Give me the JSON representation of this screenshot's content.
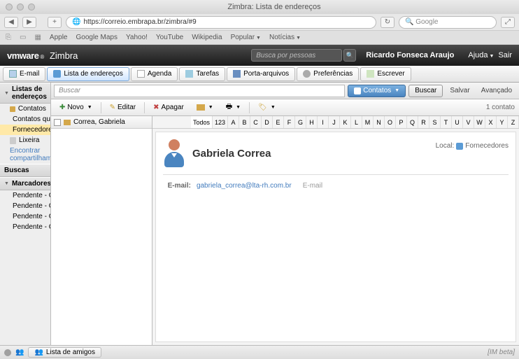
{
  "window": {
    "title": "Zimbra: Lista de endereços"
  },
  "browser": {
    "url": "https://correio.embrapa.br/zimbra/#9",
    "search_placeholder": "Google",
    "bookmarks": [
      "Apple",
      "Google Maps",
      "Yahoo!",
      "YouTube",
      "Wikipedia",
      "Popular",
      "Notícias"
    ]
  },
  "header": {
    "logo_a": "vmware",
    "logo_b": "Zimbra",
    "search_placeholder": "Busca por pessoas",
    "user": "Ricardo Fonseca Araujo",
    "help": "Ajuda",
    "exit": "Sair"
  },
  "tabs": {
    "email": "E-mail",
    "addressbook": "Lista de endereços",
    "calendar": "Agenda",
    "tasks": "Tarefas",
    "briefcase": "Porta-arquivos",
    "preferences": "Preferências",
    "compose": "Escrever"
  },
  "sidebar": {
    "addressbooks": {
      "title": "Listas de endereços",
      "items": [
        {
          "label": "Contatos"
        },
        {
          "label": "Contatos que receberam e"
        },
        {
          "label": "Fornecedores",
          "selected": true
        },
        {
          "label": "Lixeira",
          "trash": true
        }
      ],
      "share_link": "Encontrar compartilhament"
    },
    "searches": {
      "title": "Buscas"
    },
    "tags": {
      "title": "Marcadores",
      "items": [
        {
          "label": "Pendente - CGI",
          "color": "tag-blue"
        },
        {
          "label": "Pendente - Chefia DTI",
          "color": "tag-green"
        },
        {
          "label": "Pendente - CPS",
          "color": "tag-orange"
        },
        {
          "label": "Pendente - CRC",
          "color": "tag-cyan"
        }
      ]
    }
  },
  "search_row": {
    "placeholder": "Buscar",
    "contacts_btn": "Contatos",
    "search_btn": "Buscar",
    "save_btn": "Salvar",
    "advanced": "Avançado"
  },
  "toolbar": {
    "new": "Novo",
    "edit": "Editar",
    "delete": "Apagar",
    "count": "1 contato"
  },
  "alpha": {
    "all": "Todos",
    "num": "123",
    "letters": [
      "A",
      "B",
      "C",
      "D",
      "E",
      "F",
      "G",
      "H",
      "I",
      "J",
      "K",
      "L",
      "M",
      "N",
      "O",
      "P",
      "Q",
      "R",
      "S",
      "T",
      "U",
      "V",
      "W",
      "X",
      "Y",
      "Z"
    ]
  },
  "list": {
    "item_name": "Correa, Gabriela"
  },
  "contact": {
    "name": "Gabriela Correa",
    "location_label": "Local:",
    "location_value": "Fornecedores",
    "email_label": "E-mail:",
    "email_value": "gabriela_correa@lta-rh.com.br",
    "email_type": "E-mail"
  },
  "footer": {
    "chat_tab": "Lista de amigos",
    "beta": "[IM beta]"
  }
}
